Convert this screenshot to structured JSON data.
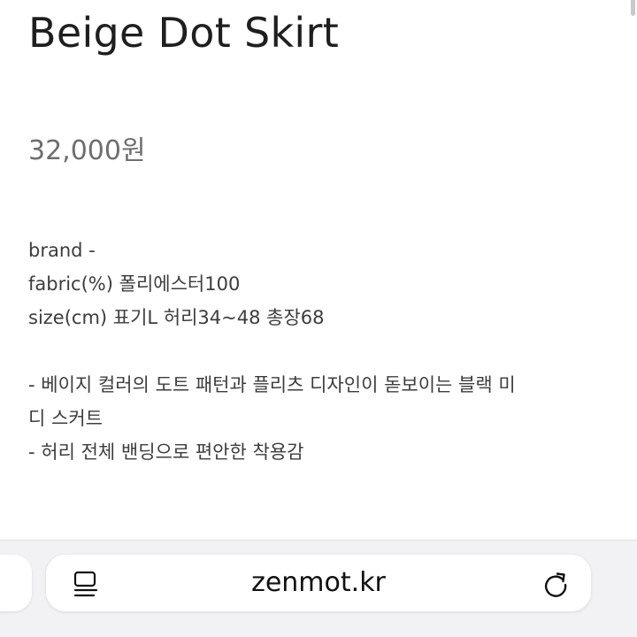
{
  "product": {
    "title": "Beige Dot Skirt",
    "price": "32,000원"
  },
  "description": {
    "brand": "brand -",
    "fabric": "fabric(%) 폴리에스터100",
    "size": "size(cm) 표기L 허리34~48 총장68",
    "bullet1_line1": "- 베이지 컬러의 도트 패턴과 플리츠 디자인이 돋보이는 블랙 미",
    "bullet1_line2": "디 스커트",
    "bullet2": "- 허리 전체 밴딩으로 편안한 착용감"
  },
  "browser": {
    "url": "zenmot.kr",
    "icons": {
      "reader": "reader-mode-icon",
      "reload": "reload-icon"
    }
  }
}
